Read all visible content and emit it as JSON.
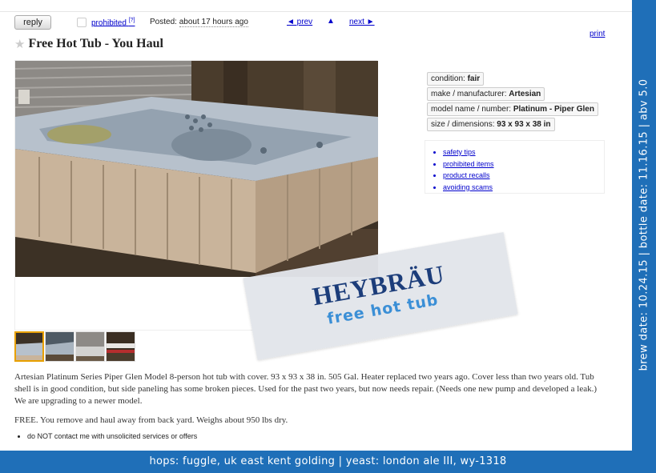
{
  "toolbar": {
    "reply_label": "reply",
    "prohibited_label": "prohibited",
    "prohibited_sup": "[?]",
    "posted_label": "Posted:",
    "posted_time": "about 17 hours ago",
    "prev_label": "◄ prev",
    "up_label": "▲",
    "next_label": "next ►",
    "print_label": "print"
  },
  "posting": {
    "title": "Free Hot Tub - You Haul",
    "star_icon": "star-icon"
  },
  "attributes": [
    {
      "key": "condition: ",
      "value": "fair"
    },
    {
      "key": "make / manufacturer: ",
      "value": "Artesian"
    },
    {
      "key": "model name / number: ",
      "value": "Platinum - Piper Glen"
    },
    {
      "key": "size / dimensions: ",
      "value": "93 x 93 x 38 in"
    }
  ],
  "safety_links": [
    "safety tips",
    "prohibited items",
    "product recalls",
    "avoiding scams"
  ],
  "body": {
    "description": "Artesian Platinum Series Piper Glen Model 8-person hot tub with cover. 93 x 93 x 38 in. 505 Gal. Heater replaced two years ago. Cover less than two years old. Tub shell is in good condition, but side paneling has some broken pieces. Used for the past two years, but now needs repair. (Needs one new pump and developed a leak.) We are upgrading to a newer model.",
    "free_text": "FREE. You remove and haul away from back yard. Weighs about 950 lbs dry.",
    "notice": "do NOT contact me with unsolicited services or offers"
  },
  "label": {
    "brand": "HEYBRÄU",
    "beer_name": "free hot tub"
  },
  "beer_info": {
    "footer": "hops: fuggle, uk east kent golding | yeast: london ale III, wy-1318",
    "side": "brew date: 10.24.15 | bottle date: 11.16.15 | abv 5.0"
  },
  "colors": {
    "band": "#1f6fb8",
    "brand": "#1c3d7a",
    "beer_name": "#3b8fd6",
    "link": "#0000cc"
  }
}
